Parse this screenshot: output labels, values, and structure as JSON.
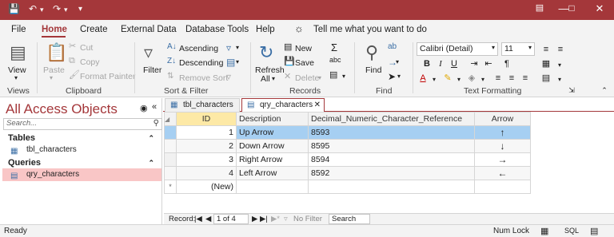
{
  "titlebar": {
    "save_icon": "save-icon",
    "undo_icon": "undo-icon",
    "redo_icon": "redo-icon",
    "customize_icon": "customize-icon",
    "ribbon_display_icon": "ribbon-display-icon",
    "minimize_icon": "minimize-icon",
    "maximize_icon": "maximize-icon",
    "close_icon": "close-icon",
    "color": "#a4373a"
  },
  "menu": {
    "items": [
      "File",
      "Home",
      "Create",
      "External Data",
      "Database Tools",
      "Help"
    ],
    "active": "Home",
    "tell_me": "Tell me what you want to do"
  },
  "ribbon": {
    "views": {
      "view": "View",
      "label": "Views"
    },
    "clipboard": {
      "paste": "Paste",
      "cut": "Cut",
      "copy": "Copy",
      "format_painter": "Format Painter",
      "label": "Clipboard"
    },
    "sort_filter": {
      "filter": "Filter",
      "ascending": "Ascending",
      "descending": "Descending",
      "remove_sort": "Remove Sort",
      "label": "Sort & Filter"
    },
    "records": {
      "refresh": "Refresh",
      "refresh_all": "All",
      "new": "New",
      "save": "Save",
      "delete": "Delete",
      "label": "Records"
    },
    "find": {
      "find": "Find",
      "label": "Find"
    },
    "text_formatting": {
      "font": "Calibri (Detail)",
      "size": "11",
      "bold": "B",
      "italic": "I",
      "underline": "U",
      "font_color": "A",
      "label": "Text Formatting"
    }
  },
  "nav": {
    "title": "All Access Objects",
    "search_placeholder": "Search...",
    "groups": [
      {
        "label": "Tables",
        "items": [
          "tbl_characters"
        ]
      },
      {
        "label": "Queries",
        "items": [
          "qry_characters"
        ]
      }
    ]
  },
  "tabs": [
    {
      "label": "tbl_characters",
      "active": false
    },
    {
      "label": "qry_characters",
      "active": true
    }
  ],
  "sheet": {
    "columns": [
      "ID",
      "Description",
      "Decimal_Numeric_Character_Reference",
      "Arrow"
    ],
    "rows": [
      {
        "id": "1",
        "description": "Up Arrow",
        "ref": "8593",
        "arrow": "↑"
      },
      {
        "id": "2",
        "description": "Down Arrow",
        "ref": "8595",
        "arrow": "↓"
      },
      {
        "id": "3",
        "description": "Right Arrow",
        "ref": "8594",
        "arrow": "→"
      },
      {
        "id": "4",
        "description": "Left Arrow",
        "ref": "8592",
        "arrow": "←"
      }
    ],
    "new_row_id": "(New)",
    "new_row_marker": "*",
    "selected_row_color": "#a6cff2"
  },
  "record_nav": {
    "label": "Record:",
    "position": "1 of 4",
    "no_filter": "No Filter",
    "search": "Search"
  },
  "status": {
    "left": "Ready",
    "num_lock": "Num Lock",
    "sql": "SQL"
  }
}
